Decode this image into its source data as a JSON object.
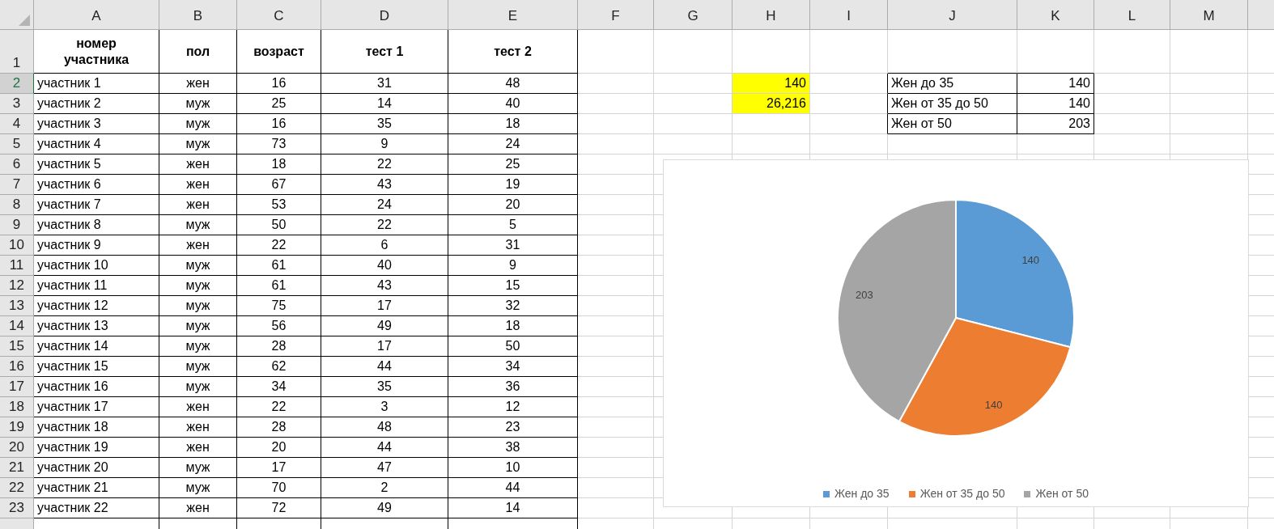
{
  "column_headers": [
    "A",
    "B",
    "C",
    "D",
    "E",
    "F",
    "G",
    "H",
    "I",
    "J",
    "K",
    "L",
    "M"
  ],
  "row_headers": [
    {
      "label": "1",
      "selected": false
    },
    {
      "label": "2",
      "selected": true
    },
    {
      "label": "3",
      "selected": false
    },
    {
      "label": "4",
      "selected": false
    },
    {
      "label": "5",
      "selected": false
    },
    {
      "label": "6",
      "selected": false
    },
    {
      "label": "7",
      "selected": false
    },
    {
      "label": "8",
      "selected": false
    },
    {
      "label": "9",
      "selected": false
    },
    {
      "label": "10",
      "selected": false
    },
    {
      "label": "11",
      "selected": false
    },
    {
      "label": "12",
      "selected": false
    },
    {
      "label": "13",
      "selected": false
    },
    {
      "label": "14",
      "selected": false
    },
    {
      "label": "15",
      "selected": false
    },
    {
      "label": "16",
      "selected": false
    },
    {
      "label": "17",
      "selected": false
    },
    {
      "label": "18",
      "selected": false
    },
    {
      "label": "19",
      "selected": false
    },
    {
      "label": "20",
      "selected": false
    },
    {
      "label": "21",
      "selected": false
    },
    {
      "label": "22",
      "selected": false
    },
    {
      "label": "23",
      "selected": false
    }
  ],
  "table": {
    "columns": [
      "номер участника",
      "пол",
      "возраст",
      "тест 1",
      "тест 2"
    ],
    "rows": [
      [
        "участник 1",
        "жен",
        "16",
        "31",
        "48"
      ],
      [
        "участник 2",
        "муж",
        "25",
        "14",
        "40"
      ],
      [
        "участник 3",
        "муж",
        "16",
        "35",
        "18"
      ],
      [
        "участник 4",
        "муж",
        "73",
        "9",
        "24"
      ],
      [
        "участник 5",
        "жен",
        "18",
        "22",
        "25"
      ],
      [
        "участник 6",
        "жен",
        "67",
        "43",
        "19"
      ],
      [
        "участник 7",
        "жен",
        "53",
        "24",
        "20"
      ],
      [
        "участник 8",
        "муж",
        "50",
        "22",
        "5"
      ],
      [
        "участник 9",
        "жен",
        "22",
        "6",
        "31"
      ],
      [
        "участник 10",
        "муж",
        "61",
        "40",
        "9"
      ],
      [
        "участник 11",
        "муж",
        "61",
        "43",
        "15"
      ],
      [
        "участник 12",
        "муж",
        "75",
        "17",
        "32"
      ],
      [
        "участник 13",
        "муж",
        "56",
        "49",
        "18"
      ],
      [
        "участник 14",
        "муж",
        "28",
        "17",
        "50"
      ],
      [
        "участник 15",
        "муж",
        "62",
        "44",
        "34"
      ],
      [
        "участник 16",
        "муж",
        "34",
        "35",
        "36"
      ],
      [
        "участник 17",
        "жен",
        "22",
        "3",
        "12"
      ],
      [
        "участник 18",
        "жен",
        "28",
        "48",
        "23"
      ],
      [
        "участник 19",
        "жен",
        "20",
        "44",
        "38"
      ],
      [
        "участник 20",
        "муж",
        "17",
        "47",
        "10"
      ],
      [
        "участник 21",
        "муж",
        "70",
        "2",
        "44"
      ],
      [
        "участник 22",
        "жен",
        "72",
        "49",
        "14"
      ]
    ]
  },
  "highlighted_cells": [
    {
      "value": "140",
      "highlighted": true
    },
    {
      "value": "26,216",
      "highlighted": true
    }
  ],
  "summary_table": [
    {
      "label": "Жен до 35",
      "value": "140"
    },
    {
      "label": "Жен от 35 до 50",
      "value": "140"
    },
    {
      "label": "Жен от 50",
      "value": "203"
    }
  ],
  "chart": {
    "chart_data": {
      "type": "pie",
      "categories": [
        "Жен до 35",
        "Жен от 35 до 50",
        "Жен от 50"
      ],
      "series": [
        {
          "values": [
            140,
            140,
            203
          ]
        }
      ],
      "colors": [
        "#5b9bd5",
        "#ed7d31",
        "#a5a5a5"
      ],
      "data_labels": true,
      "legend": true
    }
  }
}
